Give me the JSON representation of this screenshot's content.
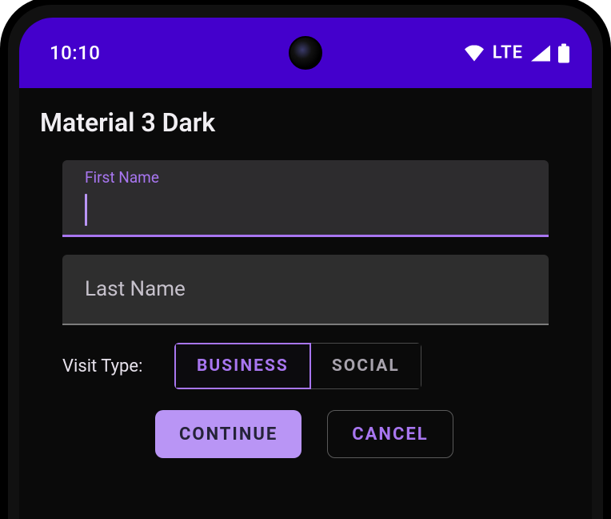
{
  "status": {
    "time": "10:10",
    "network_label": "LTE"
  },
  "heading": "Material 3 Dark",
  "form": {
    "first_name": {
      "label": "First Name",
      "value": ""
    },
    "last_name": {
      "placeholder": "Last Name",
      "value": ""
    },
    "visit_type": {
      "label": "Visit Type:",
      "options": {
        "business": "Business",
        "social": "Social"
      },
      "selected": "business"
    },
    "actions": {
      "continue": "Continue",
      "cancel": "Cancel"
    }
  },
  "colors": {
    "accent": "#A876F0",
    "statusbar": "#4400CC",
    "background": "#0A0A0A",
    "surface": "#2D2C2E"
  }
}
